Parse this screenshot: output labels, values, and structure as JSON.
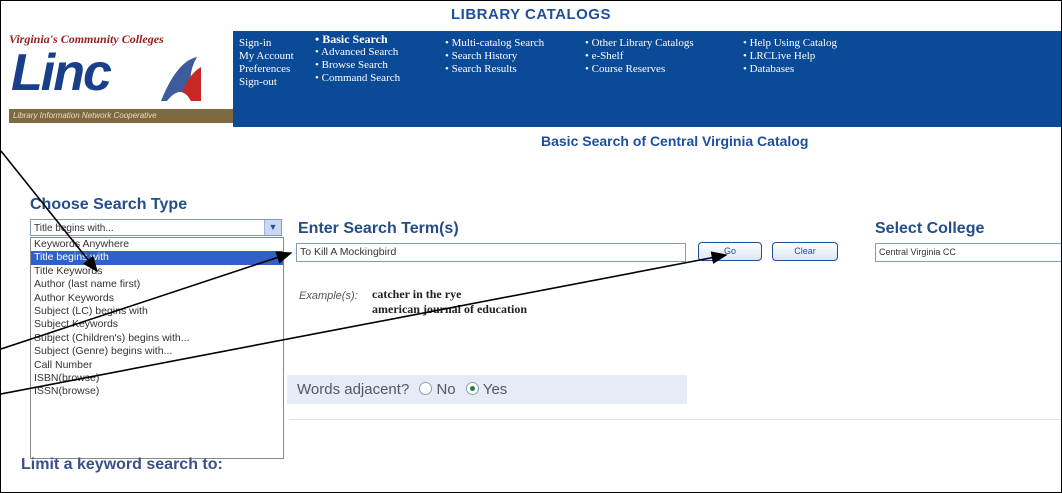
{
  "header": {
    "title": "LIBRARY CATALOGS"
  },
  "logo": {
    "tagline": "Virginia's Community Colleges",
    "name": "Linc",
    "strip": "Library Information Network Cooperative"
  },
  "nav": {
    "col1": [
      "Sign-in",
      "My Account",
      "Preferences",
      "Sign-out"
    ],
    "col2": [
      "• Basic Search",
      "• Advanced Search",
      "• Browse Search",
      "• Command Search"
    ],
    "col3": [
      "• Multi-catalog Search",
      "• Search History",
      "• Search Results"
    ],
    "col4": [
      "• Other Library Catalogs",
      "• e-Shelf",
      "• Course Reserves"
    ],
    "col5": [
      "• Help Using Catalog",
      "• LRCLive Help",
      "• Databases"
    ]
  },
  "subtitle": "Basic Search of Central Virginia Catalog",
  "search_type": {
    "label": "Choose Search Type",
    "selected": "Title begins with...",
    "options": [
      "Keywords Anywhere",
      "Title begins with",
      "Title Keywords",
      "Author (last name first)",
      "Author Keywords",
      "Subject (LC) begins with",
      "Subject Keywords",
      "Subject (Children's) begins with...",
      "Subject (Genre) begins with...",
      "Call Number",
      "ISBN(browse)",
      "ISSN(browse)"
    ],
    "highlighted_index": 1
  },
  "term": {
    "label": "Enter Search Term(s)",
    "value": "To Kill A Mockingbird",
    "go_label": "Go",
    "clear_label": "Clear"
  },
  "college": {
    "label": "Select College",
    "value": "Central Virginia CC"
  },
  "example": {
    "label": "Example(s):",
    "values": [
      "catcher in the rye",
      "american journal of education"
    ]
  },
  "adjacent": {
    "label": "Words adjacent?",
    "no_label": "No",
    "yes_label": "Yes",
    "selected": "Yes"
  },
  "limit": {
    "label": "Limit a keyword search to:"
  },
  "colors": {
    "nav_bg": "#0b4a97",
    "title": "#1f4e9a",
    "highlight": "#3161c8"
  }
}
